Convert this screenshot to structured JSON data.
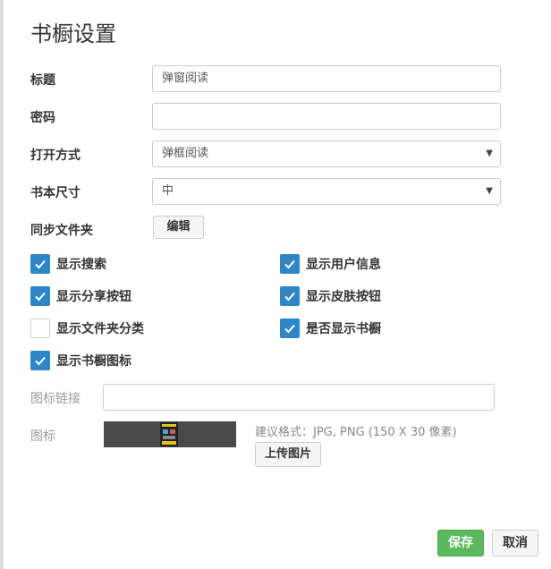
{
  "dialog": {
    "title": "书橱设置"
  },
  "form": {
    "title_label": "标题",
    "title_value": "弹窗阅读",
    "password_label": "密码",
    "password_value": "",
    "open_mode_label": "打开方式",
    "open_mode_value": "弹框阅读",
    "book_size_label": "书本尺寸",
    "book_size_value": "中",
    "sync_folder_label": "同步文件夹",
    "edit_button": "编辑"
  },
  "options": [
    {
      "label": "显示搜索",
      "checked": true
    },
    {
      "label": "显示用户信息",
      "checked": true
    },
    {
      "label": "显示分享按钮",
      "checked": true
    },
    {
      "label": "显示皮肤按钮",
      "checked": true
    },
    {
      "label": "显示文件夹分类",
      "checked": false
    },
    {
      "label": "是否显示书橱",
      "checked": true
    },
    {
      "label": "显示书橱图标",
      "checked": true
    }
  ],
  "icon_section": {
    "link_label": "图标链接",
    "link_value": "",
    "icon_label": "图标",
    "hint": "建议格式：JPG, PNG (150 X 30 像素)",
    "upload_button": "上传图片"
  },
  "footer": {
    "save": "保存",
    "cancel": "取消"
  },
  "colors": {
    "checkbox_checked": "#2f86c7",
    "save_button": "#5cb85c"
  }
}
